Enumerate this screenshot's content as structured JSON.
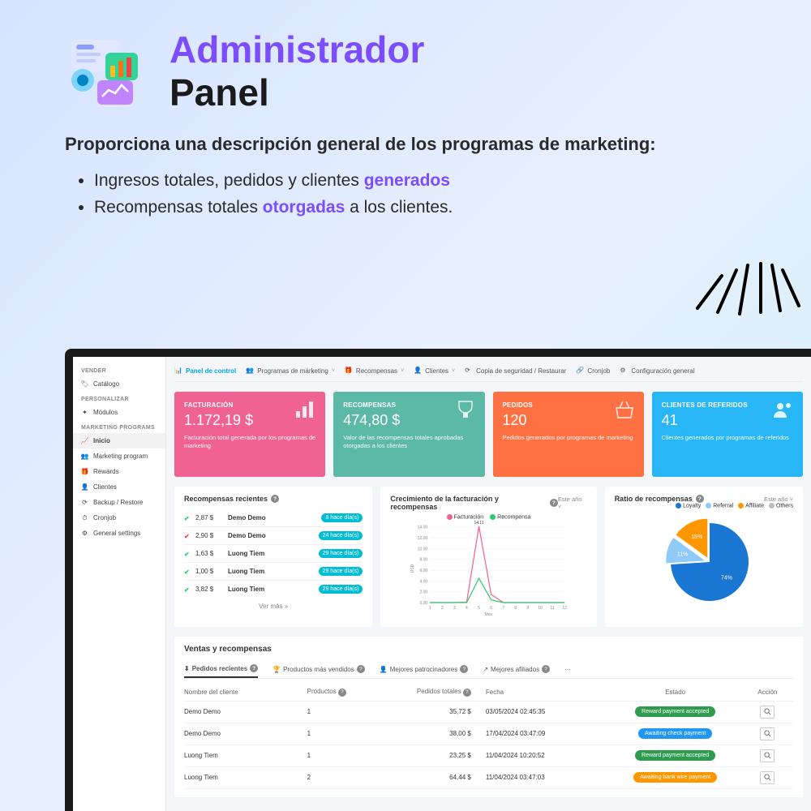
{
  "header": {
    "title_purple": "Administrador",
    "title_black": "Panel",
    "subtitle": "Proporciona una descripción general de los programas de marketing:",
    "bullet1_pre": "Ingresos totales, pedidos y clientes ",
    "bullet1_purple": "generados",
    "bullet2_pre": "Recompensas totales ",
    "bullet2_purple": "otorgadas",
    "bullet2_post": " a los clientes."
  },
  "sidebar": {
    "sec_vender": "VENDER",
    "catalogo": "Catálogo",
    "sec_personalizar": "PERSONALIZAR",
    "modulos": "Módulos",
    "sec_programs": "MARKETING PROGRAMS",
    "inicio": "Inicio",
    "marketing": "Marketing program",
    "rewards": "Rewards",
    "clientes": "Clientes",
    "backup": "Backup / Restore",
    "cronjob": "Cronjob",
    "general": "General settings"
  },
  "tabs": {
    "panel": "Panel de control",
    "programas": "Programas de márketing",
    "recompensas": "Recompensas",
    "clientes": "Clientes",
    "backup": "Copia de seguridad / Restaurar",
    "cronjob": "Cronjob",
    "config": "Configuración general"
  },
  "kpi": {
    "fact_title": "FACTURACIÓN",
    "fact_value": "1.172,19 $",
    "fact_desc": "Facturación total generada por los programas de marketing",
    "rec_title": "RECOMPENSAS",
    "rec_value": "474,80 $",
    "rec_desc": "Valor de las recompensas totales aprobadas otorgadas a los clientes",
    "ped_title": "PEDIDOS",
    "ped_value": "120",
    "ped_desc": "Pedidos generados por programas de marketing",
    "cli_title": "CLIENTES DE REFERIDOS",
    "cli_value": "41",
    "cli_desc": "Clientes generados por programas de referidos"
  },
  "recent": {
    "title": "Recompensas recientes",
    "rows": [
      {
        "amount": "2,87 $",
        "name": "Demo Demo",
        "time": "8 hace día(s)",
        "ok": true
      },
      {
        "amount": "2,90 $",
        "name": "Demo Demo",
        "time": "24 hace día(s)",
        "ok": false
      },
      {
        "amount": "1,63 $",
        "name": "Luong Tiem",
        "time": "29 hace día(s)",
        "ok": true
      },
      {
        "amount": "1,00 $",
        "name": "Luong Tiem",
        "time": "29 hace día(s)",
        "ok": true
      },
      {
        "amount": "3,82 $",
        "name": "Luong Tiem",
        "time": "29 hace día(s)",
        "ok": true
      }
    ],
    "ver_mas": "Ver más  »"
  },
  "growth": {
    "title": "Crecimiento de la facturación y recompensas",
    "period": "Este año ˅",
    "leg_fact": "Facturación",
    "leg_rec": "Recompensa",
    "xlabel": "Mes",
    "ylabel": "USD",
    "peak": "14.11"
  },
  "chart_data": {
    "type": "line",
    "x": [
      1,
      2,
      3,
      4,
      5,
      6,
      7,
      8,
      9,
      10,
      11,
      12
    ],
    "series": [
      {
        "name": "Facturación",
        "color": "#f06292",
        "values": [
          0,
          0,
          0,
          0.1,
          14.11,
          1.5,
          0,
          0,
          0,
          0,
          0,
          0
        ]
      },
      {
        "name": "Recompensa",
        "color": "#2ecc71",
        "values": [
          0,
          0,
          0,
          0,
          4.5,
          0.5,
          0,
          0,
          0,
          0,
          0,
          0
        ]
      }
    ],
    "ylim": [
      0,
      14.11
    ],
    "yticks": [
      0,
      2,
      4,
      6,
      8,
      10,
      12,
      14
    ],
    "xlabel": "Mes",
    "ylabel": "USD"
  },
  "ratio": {
    "title": "Ratio de recompensas",
    "period": "Este año ˅",
    "leg": [
      "Loyalty",
      "Referral",
      "Affiliate",
      "Others"
    ],
    "leg_colors": [
      "#1976d2",
      "#90caf9",
      "#ff9800",
      "#bdbdbd"
    ],
    "slices": [
      {
        "label": "74%",
        "value": 74,
        "color": "#1976d2"
      },
      {
        "label": "11%",
        "value": 11,
        "color": "#90caf9"
      },
      {
        "label": "15%",
        "value": 15,
        "color": "#ff9800"
      }
    ]
  },
  "sales": {
    "title": "Ventas y recompensas",
    "tabs": {
      "pedidos": "Pedidos recientes",
      "productos": "Productos más vendidos",
      "patroc": "Mejores patrocinadores",
      "afil": "Mejores afiliados",
      "more": "···"
    },
    "cols": {
      "name": "Nombre del cliente",
      "prod": "Productos",
      "total": "Pedidos totales",
      "date": "Fecha",
      "status": "Estado",
      "action": "Acción"
    },
    "rows": [
      {
        "name": "Demo Demo",
        "prod": "1",
        "total": "35,72 $",
        "date": "03/05/2024 02:45:35",
        "status": "Reward payment accepted",
        "cls": "s-green"
      },
      {
        "name": "Demo Demo",
        "prod": "1",
        "total": "38,00 $",
        "date": "17/04/2024 03:47:09",
        "status": "Awaiting check payment",
        "cls": "s-blue"
      },
      {
        "name": "Luong Tiem",
        "prod": "1",
        "total": "23,25 $",
        "date": "11/04/2024 10:20:52",
        "status": "Reward payment accepted",
        "cls": "s-green"
      },
      {
        "name": "Luong Tiem",
        "prod": "2",
        "total": "64,44 $",
        "date": "11/04/2024 03:47:03",
        "status": "Awaiting bank wire payment",
        "cls": "s-orange"
      }
    ]
  }
}
